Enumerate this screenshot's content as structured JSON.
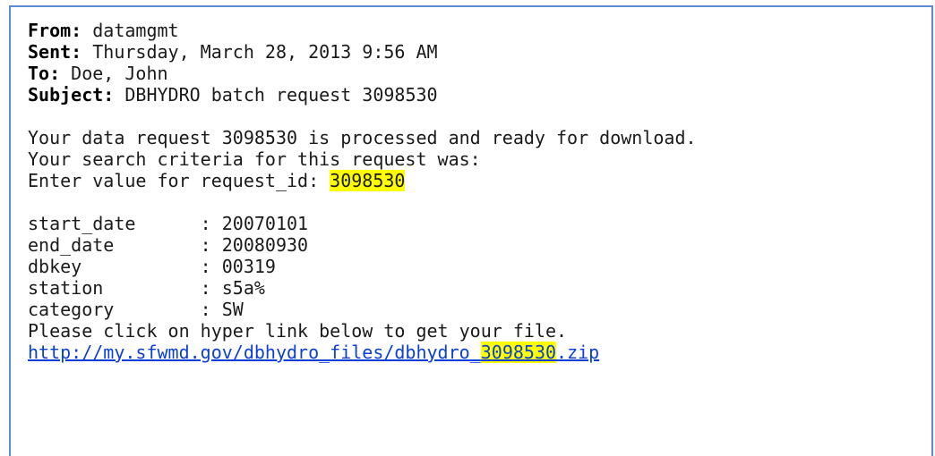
{
  "header": {
    "from_label": "From:",
    "from_value": "datamgmt",
    "sent_label": "Sent:",
    "sent_value": "Thursday, March 28, 2013 9:56 AM",
    "to_label": "To:",
    "to_value": "Doe, John",
    "subject_label": "Subject:",
    "subject_value": "DBHYDRO batch request 3098530"
  },
  "body": {
    "line1": "Your data request 3098530 is processed and ready for download.",
    "line2": "Your search criteria for this request was:",
    "line3_prefix": "Enter value for request_id: ",
    "request_id": "3098530",
    "criteria": [
      {
        "key": "start_date      ",
        "sep": ": ",
        "value": "20070101"
      },
      {
        "key": "end_date        ",
        "sep": ": ",
        "value": "20080930"
      },
      {
        "key": "dbkey           ",
        "sep": ": ",
        "value": "00319"
      },
      {
        "key": "station         ",
        "sep": ": ",
        "value": "s5a%"
      },
      {
        "key": "category        ",
        "sep": ": ",
        "value": "SW"
      }
    ],
    "click_note": "Please click on hyper link below to get your file.",
    "link_prefix": "http://my.sfwmd.gov/dbhydro_files/dbhydro_",
    "link_id": "3098530",
    "link_suffix": ".zip"
  },
  "colors": {
    "border": "#5b8bd0",
    "highlight": "#ffff00",
    "link": "#0b3fd8"
  }
}
